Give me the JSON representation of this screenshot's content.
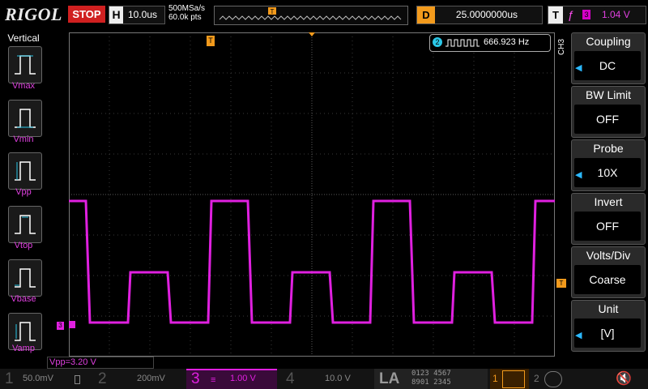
{
  "header": {
    "brand": "RIGOL",
    "run_status": "STOP",
    "horizontal_label": "H",
    "timebase": "10.0us",
    "sample_rate": "500MSa/s",
    "memory_depth": "60.0k pts",
    "delay_label": "D",
    "delay_value": "25.0000000us",
    "trigger_label": "T",
    "trigger_channel": "3",
    "trigger_level": "1.04 V"
  },
  "left_menu": {
    "title": "Vertical",
    "items": [
      {
        "label": "Vmax"
      },
      {
        "label": "Vmin"
      },
      {
        "label": "Vpp"
      },
      {
        "label": "Vtop"
      },
      {
        "label": "Vbase"
      },
      {
        "label": "Vamp"
      }
    ]
  },
  "right_menu": {
    "channel_label": "CH3",
    "items": [
      {
        "label": "Coupling",
        "value": "DC"
      },
      {
        "label": "BW Limit",
        "value": "OFF"
      },
      {
        "label": "Probe",
        "value": "10X"
      },
      {
        "label": "Invert",
        "value": "OFF"
      },
      {
        "label": "Volts/Div",
        "value": "Coarse"
      },
      {
        "label": "Unit",
        "value": "[V]"
      }
    ]
  },
  "frequency_counter": {
    "channel": "2",
    "value": "666.923 Hz"
  },
  "measurement": {
    "text": "Vpp=3.20 V"
  },
  "channels": [
    {
      "number": "1",
      "scale": "50.0mV"
    },
    {
      "number": "2",
      "scale": "200mV"
    },
    {
      "number": "3",
      "scale": "1.00 V"
    },
    {
      "number": "4",
      "scale": "10.0 V"
    }
  ],
  "la": {
    "label": "LA",
    "row1": "0123 4567",
    "row2": "8901 2345"
  },
  "colors": {
    "ch3": "#e020e0",
    "ch2": "#2bc8e8",
    "accent_orange": "#f29a1c",
    "stop_red": "#d02020"
  }
}
